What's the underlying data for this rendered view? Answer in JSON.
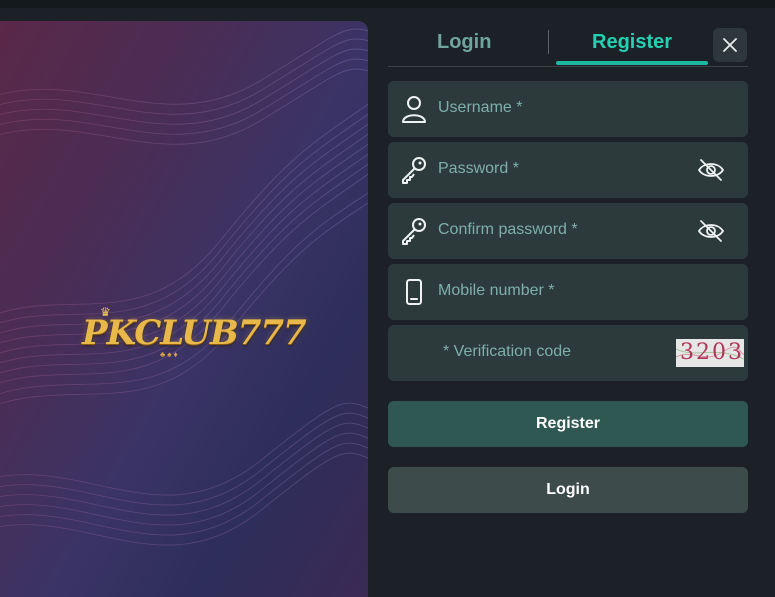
{
  "logo": {
    "brand": "PKCLUB777"
  },
  "tabs": [
    {
      "label": "Login",
      "active": false
    },
    {
      "label": "Register",
      "active": true
    }
  ],
  "form": {
    "username_placeholder": "Username *",
    "password_placeholder": "Password *",
    "confirm_password_placeholder": "Confirm password *",
    "mobile_placeholder": "Mobile number *",
    "verification_placeholder": "* Verification code",
    "captcha_text": "3203"
  },
  "buttons": {
    "register_label": "Register",
    "login_label": "Login"
  },
  "icons": {
    "close": "close-icon",
    "user": "user-icon",
    "key": "key-icon",
    "eye_off": "eye-off-icon",
    "phone": "phone-icon"
  },
  "colors": {
    "accent": "#25d0b2",
    "tab_inactive": "#6fa59d",
    "field_bg": "#2d3a3c",
    "register_btn": "#2f5852",
    "login_btn": "#3d4c4b",
    "panel_bg": "#1b2126"
  }
}
